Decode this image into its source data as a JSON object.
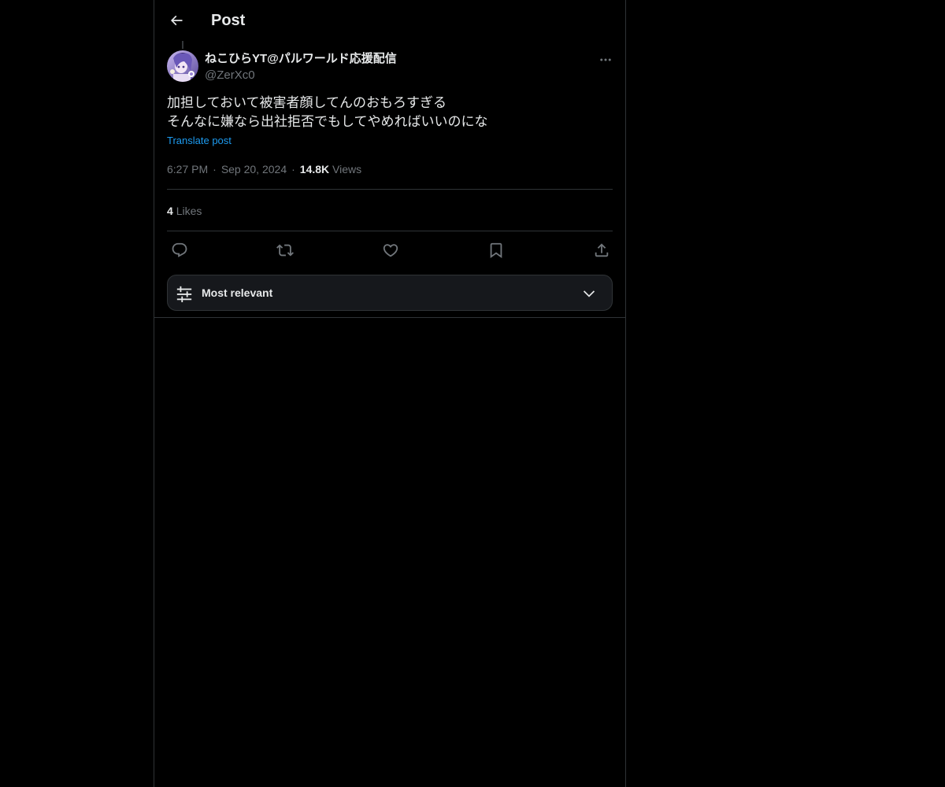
{
  "header": {
    "back_icon": "arrow-left-icon",
    "title": "Post"
  },
  "post": {
    "author": {
      "display_name": "ねこひらYT@パルワールド応援配信",
      "handle": "@ZerXc0",
      "avatar_icon": "anime-avatar"
    },
    "more_icon": "ellipsis-icon",
    "text_lines": [
      "加担しておいて被害者顔してんのおもろすぎる",
      "そんなに嫌なら出社拒否でもしてやめればいいのにな"
    ],
    "translate_label": "Translate post",
    "time": "6:27 PM",
    "date": "Sep 20, 2024",
    "separator": "·",
    "views_count": "14.8K",
    "views_label": "Views",
    "likes_count": "4",
    "likes_label": "Likes"
  },
  "actions": [
    {
      "name": "reply",
      "icon": "reply-icon"
    },
    {
      "name": "repost",
      "icon": "repost-icon"
    },
    {
      "name": "like",
      "icon": "heart-icon"
    },
    {
      "name": "bookmark",
      "icon": "bookmark-icon"
    },
    {
      "name": "share",
      "icon": "share-icon"
    }
  ],
  "sort": {
    "label": "Most relevant",
    "icon": "sliders-icon",
    "chevron": "chevron-down-icon"
  },
  "colors": {
    "background": "#000000",
    "text": "#e7e9ea",
    "secondary": "#71767b",
    "accent": "#1d9bf0",
    "border": "#2f3336"
  }
}
